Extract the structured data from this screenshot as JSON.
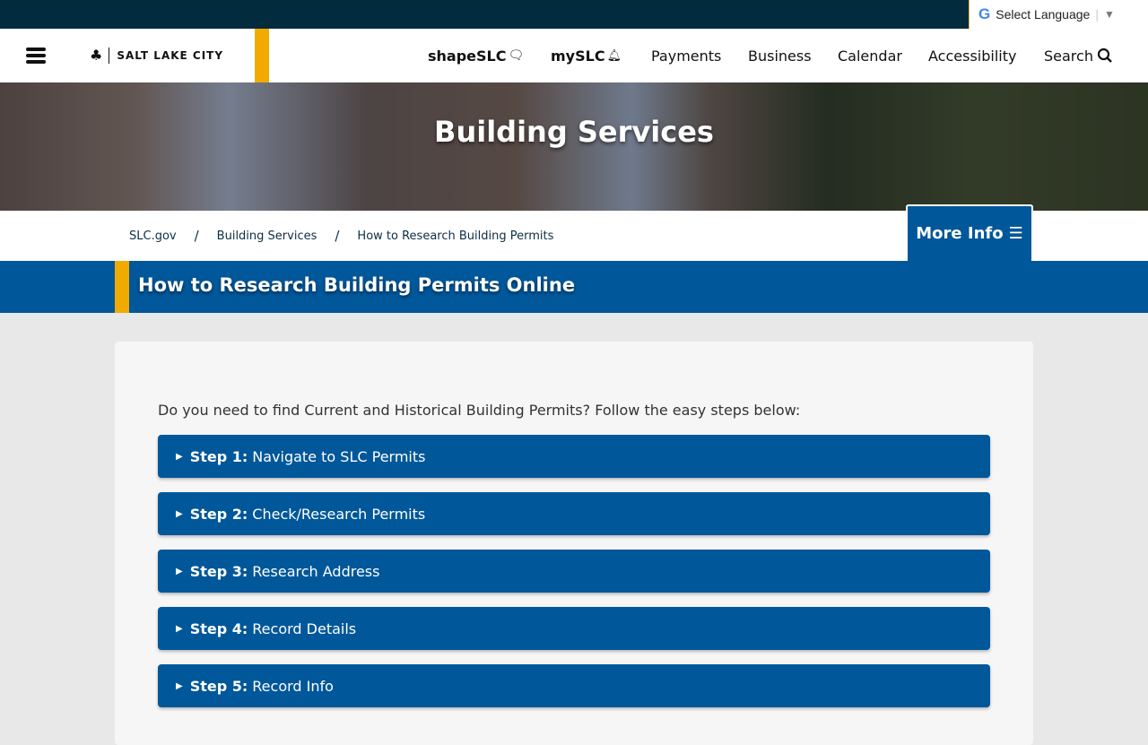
{
  "language": {
    "label": "Select Language",
    "icon": "google-icon"
  },
  "header": {
    "logo": "SALT LAKE CITY",
    "nav": [
      {
        "label": "shapeSLC",
        "icon": "chat-bubbles-icon"
      },
      {
        "label": "mySLC",
        "icon": "bell-icon"
      },
      {
        "label": "Payments"
      },
      {
        "label": "Business"
      },
      {
        "label": "Calendar"
      },
      {
        "label": "Accessibility"
      },
      {
        "label": "Search",
        "icon": "search-icon"
      }
    ]
  },
  "hero": {
    "title": "Building Services"
  },
  "breadcrumb": [
    "SLC.gov",
    "Building Services",
    "How to Research Building Permits"
  ],
  "more_info": "More Info",
  "page_title": "How to Research Building Permits Online",
  "intro": "Do you need to find Current and Historical Building Permits? Follow the easy steps below:",
  "steps": [
    {
      "label": "Step 1:",
      "text": "Navigate to SLC Permits"
    },
    {
      "label": "Step 2:",
      "text": "Check/Research Permits"
    },
    {
      "label": "Step 3:",
      "text": "Research Address"
    },
    {
      "label": "Step 4:",
      "text": "Record Details"
    },
    {
      "label": "Step 5:",
      "text": "Record Info"
    }
  ],
  "colors": {
    "brand_blue": "#00579a",
    "gold": "#f0aa00",
    "topbar": "#032b3e"
  }
}
